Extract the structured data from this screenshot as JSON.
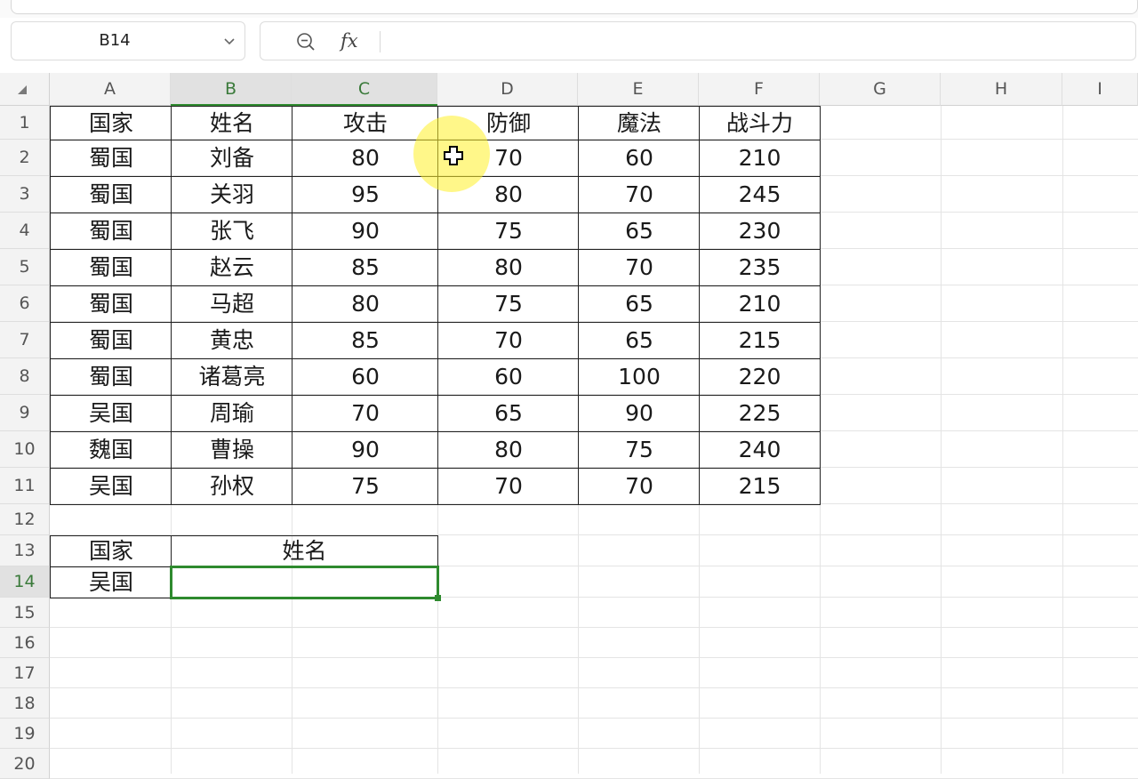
{
  "name_box": {
    "value": "B14"
  },
  "formula_bar": {
    "fx_label": "fx",
    "value": ""
  },
  "columns": [
    "A",
    "B",
    "C",
    "D",
    "E",
    "F",
    "G",
    "H",
    "I"
  ],
  "rows": [
    "1",
    "2",
    "3",
    "4",
    "5",
    "6",
    "7",
    "8",
    "9",
    "10",
    "11",
    "12",
    "13",
    "14",
    "15",
    "16",
    "17",
    "18",
    "19",
    "20"
  ],
  "table": {
    "headers": [
      "国家",
      "姓名",
      "攻击",
      "防御",
      "魔法",
      "战斗力"
    ],
    "rows": [
      [
        "蜀国",
        "刘备",
        "80",
        "70",
        "60",
        "210"
      ],
      [
        "蜀国",
        "关羽",
        "95",
        "80",
        "70",
        "245"
      ],
      [
        "蜀国",
        "张飞",
        "90",
        "75",
        "65",
        "230"
      ],
      [
        "蜀国",
        "赵云",
        "85",
        "80",
        "70",
        "235"
      ],
      [
        "蜀国",
        "马超",
        "80",
        "75",
        "65",
        "210"
      ],
      [
        "蜀国",
        "黄忠",
        "85",
        "70",
        "65",
        "215"
      ],
      [
        "蜀国",
        "诸葛亮",
        "60",
        "60",
        "100",
        "220"
      ],
      [
        "吴国",
        "周瑜",
        "70",
        "65",
        "90",
        "225"
      ],
      [
        "魏国",
        "曹操",
        "90",
        "80",
        "75",
        "240"
      ],
      [
        "吴国",
        "孙权",
        "75",
        "70",
        "70",
        "215"
      ]
    ]
  },
  "lookup": {
    "headers": [
      "国家",
      "姓名"
    ],
    "values": [
      "吴国",
      ""
    ]
  },
  "selection": {
    "cell": "B14"
  },
  "colors": {
    "selection": "#2e8a2e",
    "header_bg": "#f3f3f3",
    "cursor_highlight": "#fff028"
  },
  "icons": {
    "zoom": "zoom-search-icon",
    "dropdown": "chevron-down-icon",
    "corner": "select-all-icon",
    "cursor": "cell-select-cursor-icon"
  }
}
